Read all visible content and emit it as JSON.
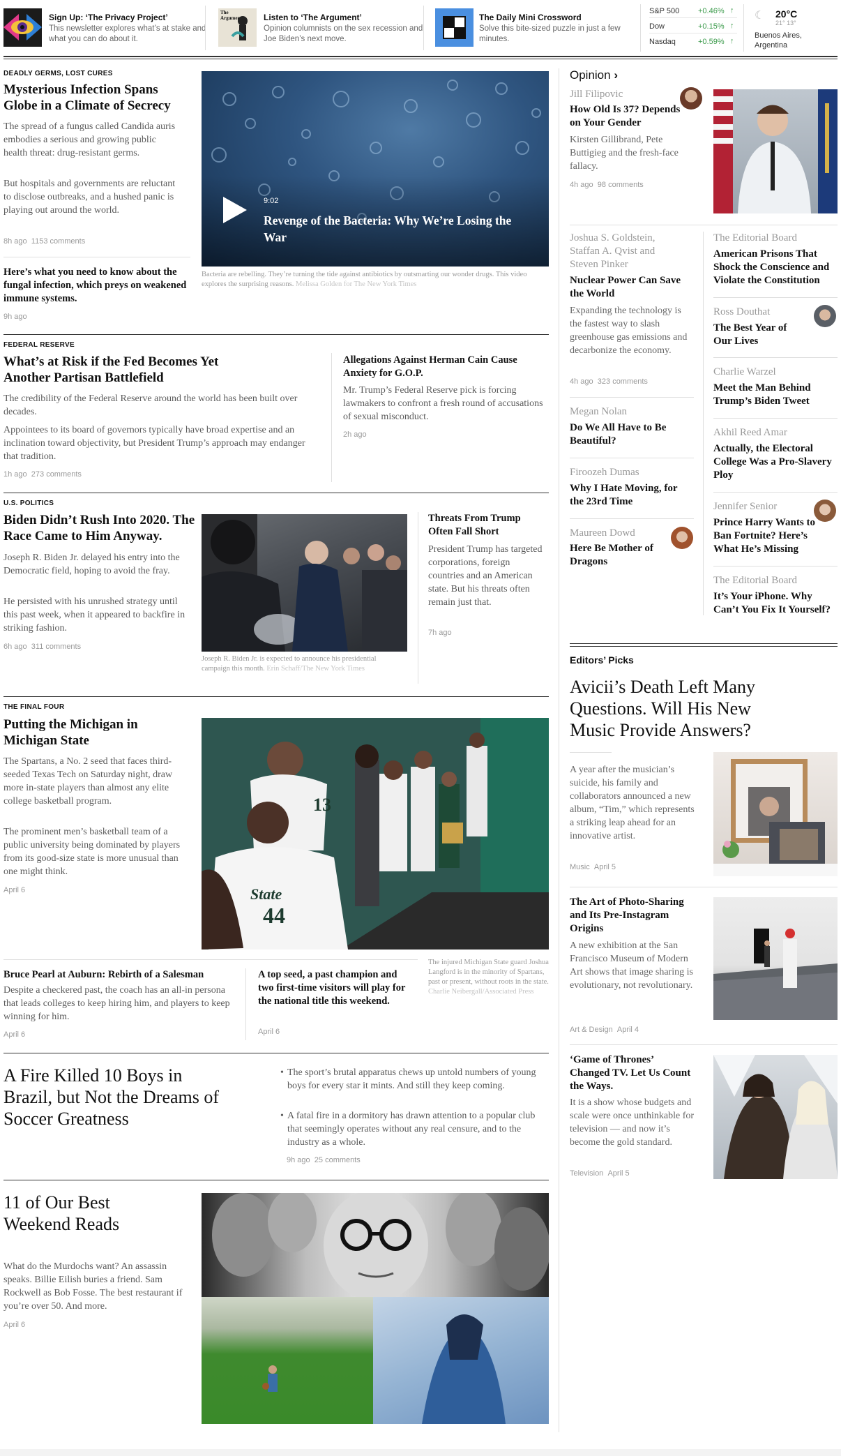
{
  "topbar": {
    "promos": [
      {
        "title": "Sign Up: ‘The Privacy Project’",
        "desc": "This newsletter explores what’s at stake and what you can do about it."
      },
      {
        "title": "Listen to ‘The Argument’",
        "desc": "Opinion columnists on the sex recession and Joe Biden’s next move.",
        "logo_text": "The Argument"
      },
      {
        "title": "The Daily Mini Crossword",
        "desc": "Solve this bite-sized puzzle in just a few minutes."
      }
    ],
    "markets": [
      {
        "name": "S&P 500",
        "change": "+0.46%"
      },
      {
        "name": "Dow",
        "change": "+0.15%"
      },
      {
        "name": "Nasdaq",
        "change": "+0.59%"
      }
    ],
    "weather": {
      "temp": "20°C",
      "range": "21° 13°",
      "city": "Buenos Aires, Argentina"
    }
  },
  "s1": {
    "kicker": "DEADLY GERMS, LOST CURES",
    "headline": "Mysterious Infection Spans Globe in a Climate of Secrecy",
    "sum1": "The spread of a fungus called Candida auris embodies a serious and growing public health threat: drug-resistant germs.",
    "sum2": "But hospitals and governments are reluctant to disclose outbreaks, and a hushed panic is playing out around the world.",
    "time": "8h ago",
    "comments": "1153 comments",
    "sub_headline": "Here’s what you need to know about the fungal infection, which preys on weakened immune systems.",
    "sub_time": "9h ago",
    "video": {
      "duration": "9:02",
      "title": "Revenge of the Bacteria: Why We’re Losing the War"
    },
    "caption": "Bacteria are rebelling. They’re turning the tide against antibiotics by outsmarting our wonder drugs. This video explores the surprising reasons.",
    "credit": "Melissa Golden for The New York Times"
  },
  "s2": {
    "kicker": "FEDERAL RESERVE",
    "headline": "What’s at Risk if the Fed Becomes Yet Another Partisan Battlefield",
    "sum1": "The credibility of the Federal Reserve around the world has been built over decades.",
    "sum2": "Appointees to its board of governors typically have broad expertise and an inclination toward objectivity, but President Trump’s approach may endanger that tradition.",
    "time": "1h ago",
    "comments": "273 comments",
    "side_headline": "Allegations Against Herman Cain Cause Anxiety for G.O.P.",
    "side_sum": "Mr. Trump’s Federal Reserve pick is forcing lawmakers to confront a fresh round of accusations of sexual misconduct.",
    "side_time": "2h ago"
  },
  "s3": {
    "kicker": "U.S. POLITICS",
    "headline": "Biden Didn’t Rush Into 2020. The Race Came to Him Anyway.",
    "sum1": "Joseph R. Biden Jr. delayed his entry into the Democratic field, hoping to avoid the fray.",
    "sum2": "He persisted with his unrushed strategy until this past week, when it appeared to backfire in striking fashion.",
    "time": "6h ago",
    "comments": "311 comments",
    "caption": "Joseph R. Biden Jr. is expected to announce his presidential campaign this month.",
    "credit": "Erin Schaff/The New York Times",
    "side_headline": "Threats From Trump Often Fall Short",
    "side_sum": "President Trump has targeted corporations, foreign countries and an American state. But his threats often remain just that.",
    "side_time": "7h ago"
  },
  "s4": {
    "kicker": "THE FINAL FOUR",
    "headline": "Putting the Michigan in Michigan State",
    "sum1": "The Spartans, a No. 2 seed that faces third-seeded Texas Tech on Saturday night, draw more in-state players than almost any elite college basketball program.",
    "sum2": "The prominent men’s basketball team of a public university being dominated by players from its good-size state is more unusual than one might think.",
    "time": "April 6",
    "sub1_headline": "Bruce Pearl at Auburn: Rebirth of a Salesman",
    "sub1_sum": "Despite a checkered past, the coach has an all-in persona that leads colleges to keep hiring him, and players to keep winning for him.",
    "sub1_time": "April 6",
    "sub2_headline": "A top seed, a past champion and two first-time visitors will play for the national title this weekend.",
    "sub2_time": "April 6",
    "caption": "The injured Michigan State guard Joshua Langford is in the minority of Spartans, past or present, without roots in the state.",
    "credit": "Charlie Neibergall/Associated Press",
    "jersey1": "44",
    "jersey2": "13",
    "jersey_word": "State"
  },
  "s5": {
    "headline": "A Fire Killed 10 Boys in Brazil, but Not the Dreams of Soccer Greatness",
    "bullet1": "The sport’s brutal apparatus chews up untold numbers of young boys for every star it mints. And still they keep coming.",
    "bullet2": "A fatal fire in a dormitory has drawn attention to a popular club that seemingly operates without any real censure, and to the industry as a whole.",
    "time": "9h ago",
    "comments": "25 comments"
  },
  "s6": {
    "headline": "11 of Our Best Weekend Reads",
    "sum": "What do the Murdochs want? An assassin speaks. Billie Eilish buries a friend. Sam Rockwell as Bob Fosse. The best restaurant if you’re over 50. And more.",
    "time": "April 6"
  },
  "opinion": {
    "label": "Opinion",
    "lead": {
      "author": "Jill Filipovic",
      "headline": "How Old Is 37? Depends on Your Gender",
      "sum": "Kirsten Gillibrand, Pete Buttigieg and the fresh-face fallacy.",
      "time": "4h ago",
      "comments": "98 comments"
    },
    "left": [
      {
        "author": "Joshua S. Goldstein, Staffan A. Qvist and Steven Pinker",
        "headline": "Nuclear Power Can Save the World",
        "sum": "Expanding the technology is the fastest way to slash greenhouse gas emissions and decarbonize the economy.",
        "time": "4h ago",
        "comments": "323 comments"
      },
      {
        "author": "Megan Nolan",
        "headline": "Do We All Have to Be Beautiful?"
      },
      {
        "author": "Firoozeh Dumas",
        "headline": "Why I Hate Moving, for the 23rd Time"
      },
      {
        "author": "Maureen Dowd",
        "headline": "Here Be Mother of Dragons"
      }
    ],
    "right": [
      {
        "author": "The Editorial Board",
        "headline": "American Prisons That Shock the Conscience and Violate the Constitution"
      },
      {
        "author": "Ross Douthat",
        "headline": "The Best Year of Our Lives"
      },
      {
        "author": "Charlie Warzel",
        "headline": "Meet the Man Behind Trump’s Biden Tweet"
      },
      {
        "author": "Akhil Reed Amar",
        "headline": "Actually, the Electoral College Was a Pro-Slavery Ploy"
      },
      {
        "author": "Jennifer Senior",
        "headline": "Prince Harry Wants to Ban Fortnite? Here’s What He’s Missing"
      },
      {
        "author": "The Editorial Board",
        "headline": "It’s Your iPhone. Why Can’t You Fix It Yourself?"
      }
    ]
  },
  "editors": {
    "label": "Editors’ Picks",
    "lead_headline": "Avicii’s Death Left Many Questions. Will His New Music Provide Answers?",
    "lead_sum": "A year after the musician’s suicide, his family and collaborators announced a new album, “Tim,” which represents a striking leap ahead for an innovative artist.",
    "lead_section": "Music",
    "lead_date": "April 5",
    "items": [
      {
        "headline": "The Art of Photo-Sharing and Its Pre-Instagram Origins",
        "sum": "A new exhibition at the San Francisco Museum of Modern Art shows that image sharing is evolutionary, not revolutionary.",
        "section": "Art & Design",
        "date": "April 4"
      },
      {
        "headline": "‘Game of Thrones’ Changed TV. Let Us Count the Ways.",
        "sum": "It is a show whose budgets and scale were once unthinkable for television — and now it’s become the gold standard.",
        "section": "Television",
        "date": "April 5"
      }
    ]
  },
  "colors": {
    "market_up": "#3a9a4a",
    "rule_dark": "#333333",
    "rule_light": "#dfdfdf",
    "meta_gray": "#999999"
  }
}
